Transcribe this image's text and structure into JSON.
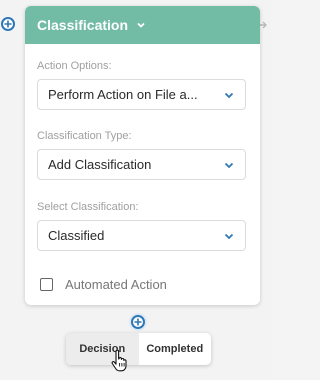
{
  "card": {
    "title": "Classification",
    "header_color": "#72bba5"
  },
  "fields": [
    {
      "label": "Action Options:",
      "value": "Perform Action on File a..."
    },
    {
      "label": "Classification Type:",
      "value": "Add Classification"
    },
    {
      "label": "Select Classification:",
      "value": "Classified"
    }
  ],
  "checkbox": {
    "label": "Automated Action",
    "checked": false
  },
  "choices": [
    {
      "label": "Decision",
      "hovered": true
    },
    {
      "label": "Completed",
      "hovered": false
    }
  ],
  "colors": {
    "accent": "#2f78b5",
    "canvas": "#f3f3f3"
  },
  "icons": [
    "add-connector-icon",
    "chevron-down-icon",
    "arrow-right-icon",
    "hand-pointer-cursor-icon"
  ]
}
